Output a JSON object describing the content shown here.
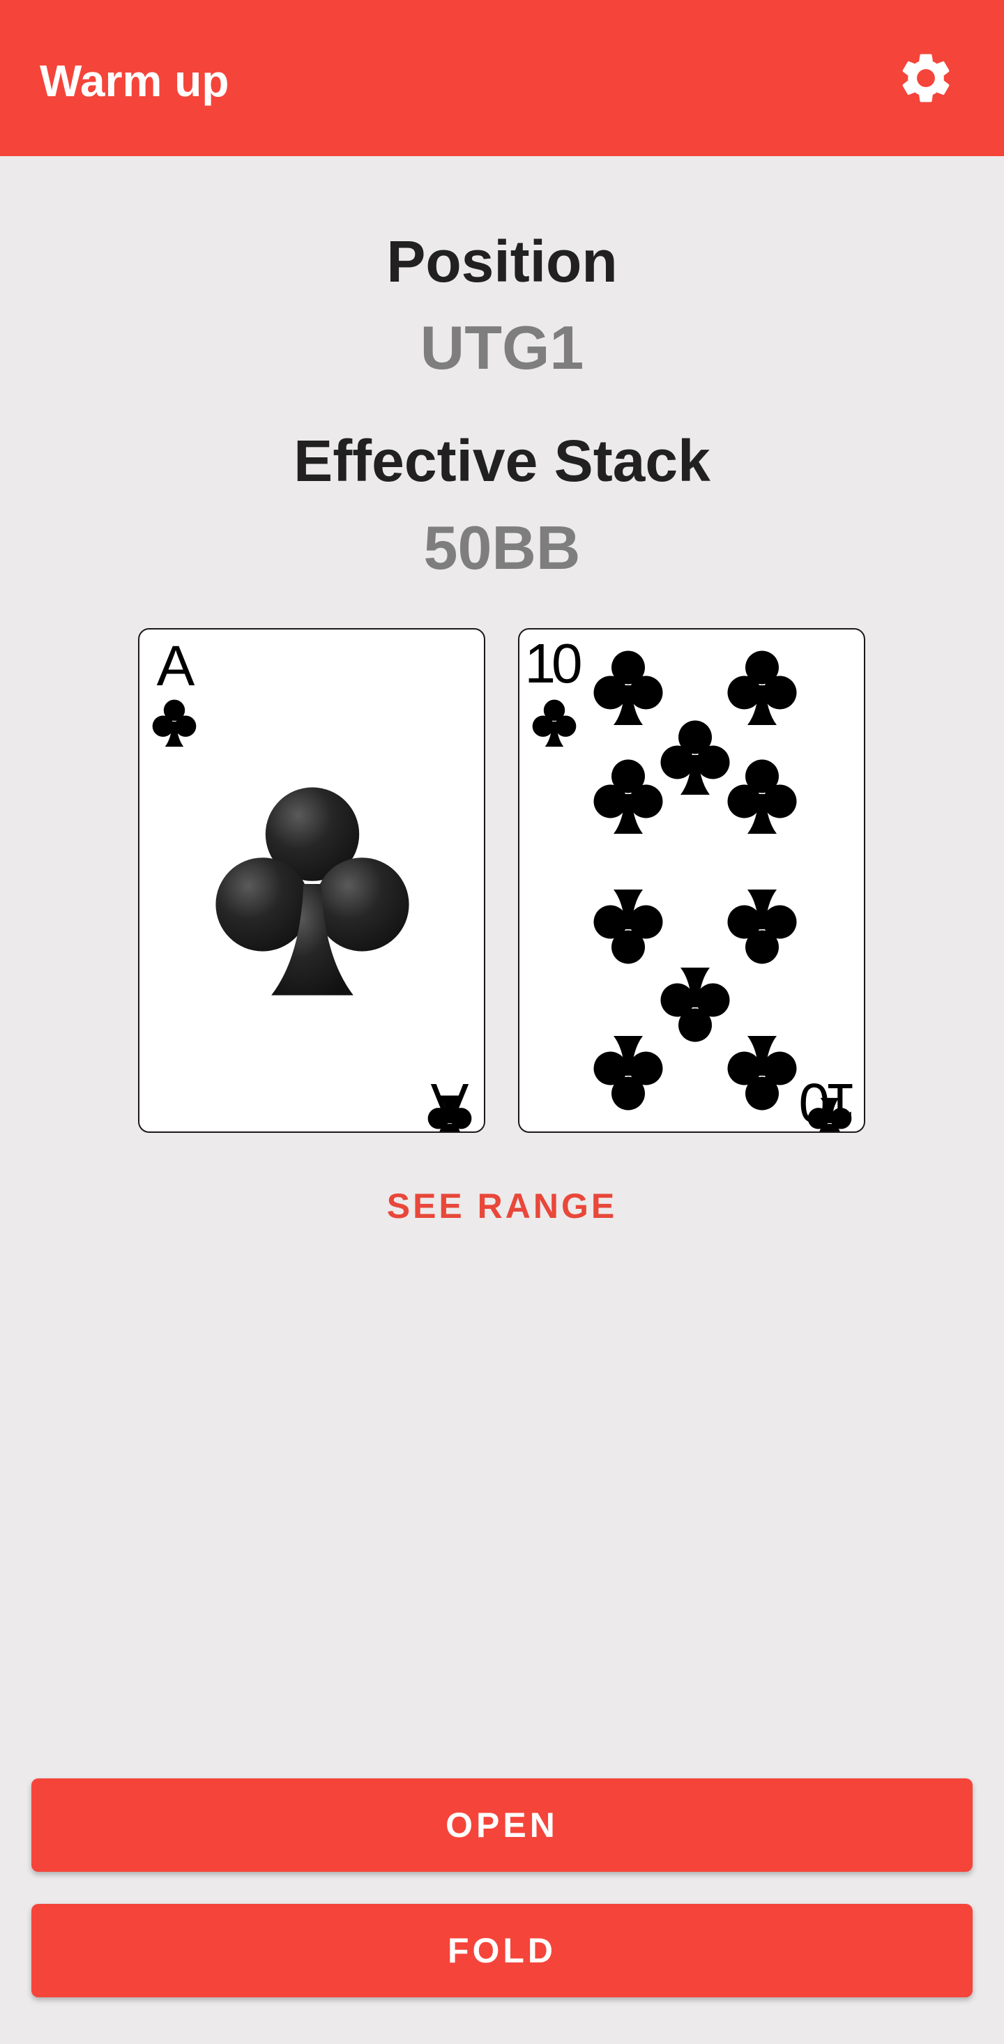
{
  "app": {
    "title": "Warm up",
    "settings_icon": "gear-icon",
    "theme": {
      "primary": "#F5443A",
      "background": "#ECEAEB",
      "text": "#212121",
      "value_text": "#7E7E7E"
    }
  },
  "position": {
    "label": "Position",
    "value": "UTG1"
  },
  "stack": {
    "label": "Effective Stack",
    "value": "50BB"
  },
  "hand": [
    {
      "rank": "A",
      "suit": "clubs",
      "suit_icon": "club-icon"
    },
    {
      "rank": "10",
      "suit": "clubs",
      "suit_icon": "club-icon"
    }
  ],
  "see_range_label": "SEE RANGE",
  "actions": {
    "open_label": "OPEN",
    "fold_label": "FOLD"
  }
}
